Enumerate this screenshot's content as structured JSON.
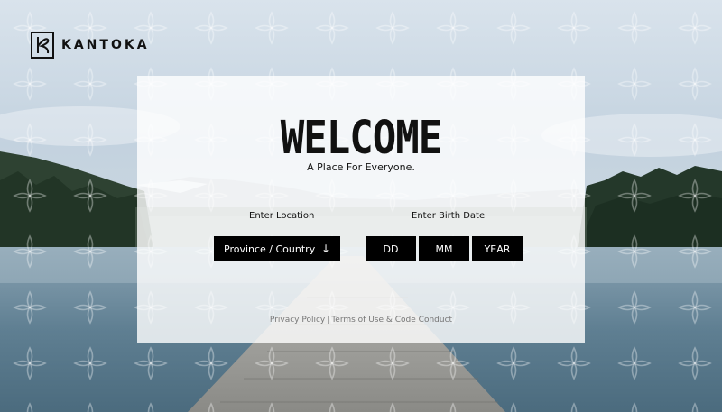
{
  "brand": {
    "name": "KANTOKA",
    "logo_icon": "kantoka-logo-icon"
  },
  "hero": {
    "title": "WELCOME",
    "tagline": "A Place For Everyone."
  },
  "form": {
    "location_label": "Enter Location",
    "location_placeholder": "Province / Country",
    "location_icon": "arrow-down-icon",
    "birth_label": "Enter Birth Date",
    "day_placeholder": "DD",
    "month_placeholder": "MM",
    "year_placeholder": "YEAR"
  },
  "footer": {
    "privacy": "Privacy Policy",
    "separator": "|",
    "terms": "Terms of Use & Code Conduct"
  },
  "colors": {
    "field_bg": "#000000",
    "field_text": "#ffffff",
    "card_bg": "#ffffff",
    "footer_text": "#777777"
  }
}
